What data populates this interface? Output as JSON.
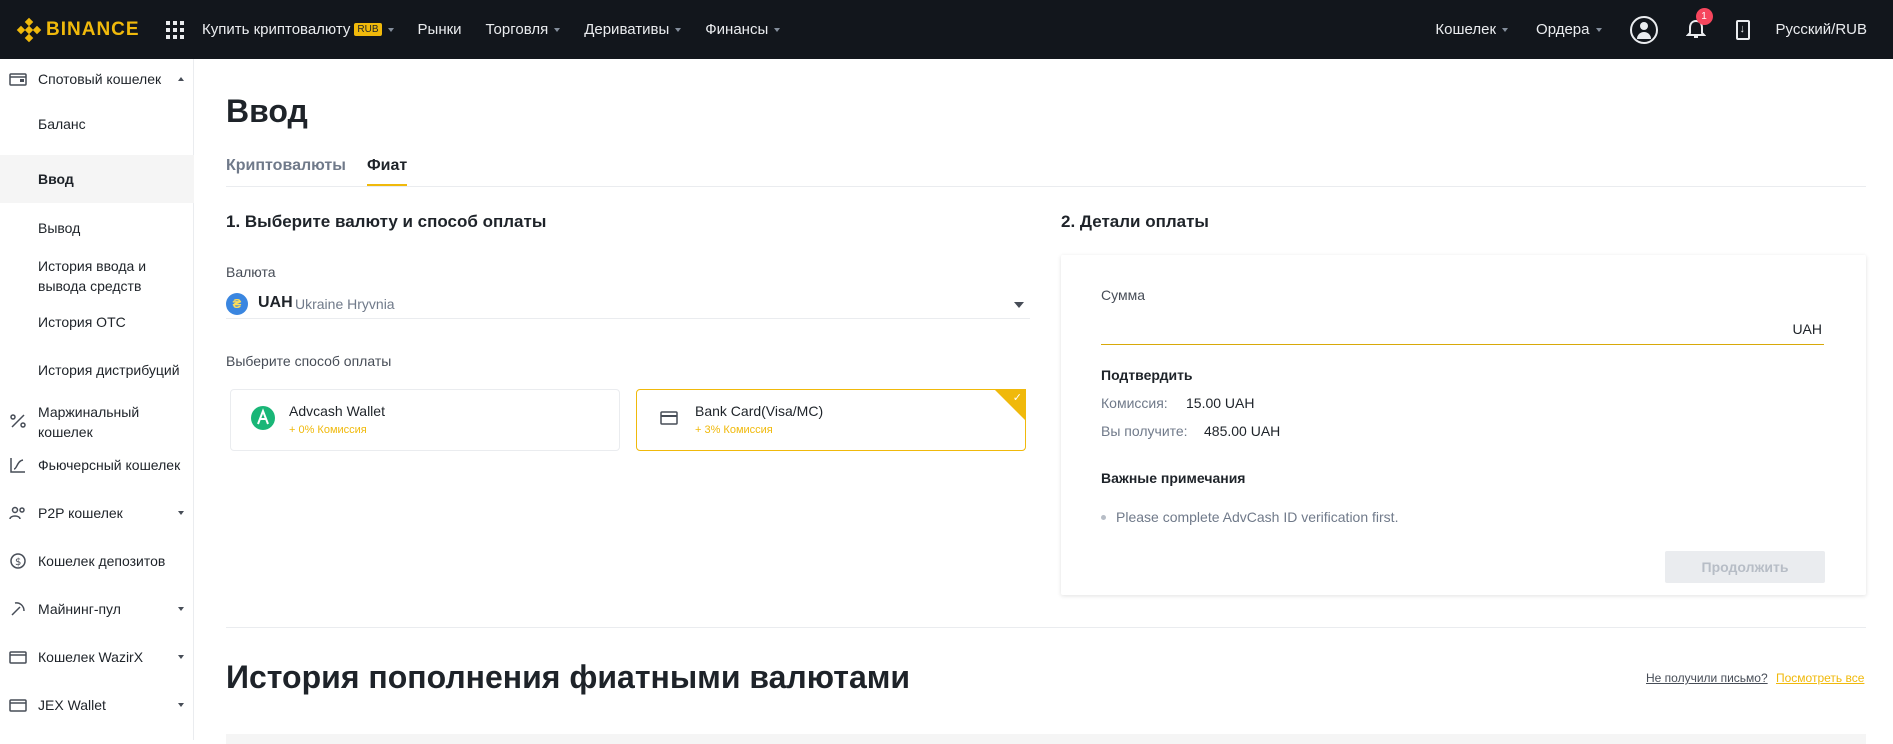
{
  "header": {
    "brand": "BINANCE",
    "nav": [
      {
        "label": "Купить криптовалюту",
        "badge": "RUB",
        "has_caret": true
      },
      {
        "label": "Рынки",
        "has_caret": false
      },
      {
        "label": "Торговля",
        "has_caret": true
      },
      {
        "label": "Деривативы",
        "has_caret": true
      },
      {
        "label": "Финансы",
        "has_caret": true
      }
    ],
    "wallet_label": "Кошелек",
    "orders_label": "Ордера",
    "notification_count": "1",
    "language": "Русский/RUB"
  },
  "sidebar": {
    "items": [
      {
        "label": "Спотовый кошелек"
      },
      {
        "label": "Баланс"
      },
      {
        "label": "Ввод"
      },
      {
        "label": "Вывод"
      },
      {
        "label": "История ввода и вывода средств"
      },
      {
        "label": "История OTC"
      },
      {
        "label": "История дистрибуций"
      },
      {
        "label": "Маржинальный кошелек"
      },
      {
        "label": "Фьючерсный кошелек"
      },
      {
        "label": "P2P кошелек"
      },
      {
        "label": "Кошелек депозитов"
      },
      {
        "label": "Майнинг-пул"
      },
      {
        "label": "Кошелек WazirX"
      },
      {
        "label": "JEX Wallet"
      }
    ]
  },
  "main": {
    "title": "Ввод",
    "tabs": [
      {
        "label": "Криптовалюты"
      },
      {
        "label": "Фиат"
      }
    ],
    "step1": {
      "title": "1. Выберите валюту и способ оплаты",
      "currency_label": "Валюта",
      "currency_symbol": "₴",
      "currency_code": "UAH",
      "currency_name": "Ukraine Hryvnia",
      "payment_label": "Выберите способ оплаты",
      "methods": [
        {
          "name": "Advcash Wallet",
          "fee": "+ 0% Комиссия"
        },
        {
          "name": "Bank Card(Visa/MC)",
          "fee": "+ 3% Комиссия"
        }
      ]
    },
    "step2": {
      "title": "2. Детали оплаты",
      "amount_label": "Сумма",
      "amount_value": "",
      "amount_unit": "UAH",
      "confirm_title": "Подтвердить",
      "fee_label": "Комиссия:",
      "fee_value": "15.00 UAH",
      "receive_label": "Вы получите:",
      "receive_value": "485.00 UAH",
      "notes_title": "Важные примечания",
      "note": "Please complete AdvCash ID verification first.",
      "continue_label": "Продолжить"
    },
    "history": {
      "title": "История пополнения фиатными валютами",
      "no_email": "Не получили письмо?",
      "see_all": "Посмотреть все"
    }
  },
  "colors": {
    "brand": "#f0b90b",
    "topbar": "#12161c",
    "text": "#1e2329",
    "muted": "#707a8a"
  }
}
